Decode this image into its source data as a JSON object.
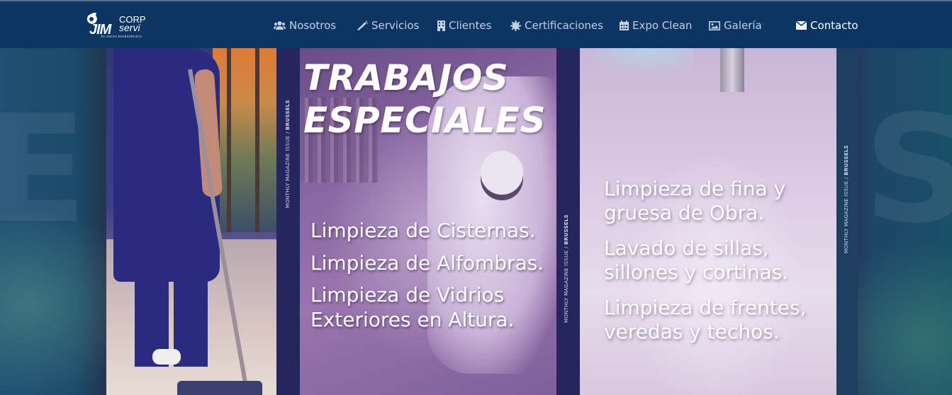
{
  "brand": {
    "logo_text_corp": "CORP",
    "logo_text_jim": "JIM",
    "logo_text_servi": "servi",
    "logo_tagline": "TU SOCIO ESTRATÉGICO"
  },
  "nav": {
    "items": [
      {
        "label": "Nosotros",
        "icon": "users-icon"
      },
      {
        "label": "Servicios",
        "icon": "spray-icon"
      },
      {
        "label": "Clientes",
        "icon": "building-icon"
      },
      {
        "label": "Certificaciones",
        "icon": "certificate-icon"
      },
      {
        "label": "Expo Clean",
        "icon": "calendar-icon"
      },
      {
        "label": "Galería",
        "icon": "image-icon"
      }
    ],
    "contact": {
      "label": "Contacto",
      "icon": "envelope-icon"
    }
  },
  "hero": {
    "headline_line1": "TRABAJOS",
    "headline_line2": "ESPECIALES",
    "strip_label_prefix": "MONTHLY MAGAZINE ISSUE /",
    "strip_label_city": "BRUSSELS",
    "services_left": [
      "Limpieza de Cisternas.",
      "Limpieza de Alfombras.",
      "Limpieza de Vidrios",
      "Exteriores en Altura."
    ],
    "services_right": [
      "Limpieza de fina y",
      "gruesa de Obra.",
      "Lavado de sillas,",
      "sillones y cortinas.",
      "Limpieza de frentes,",
      "veredas y techos."
    ]
  },
  "colors": {
    "nav_bg": "#0c3564",
    "nav_text": "#c4cfe0",
    "panel_purple": "#8a67a3",
    "panel_lilac": "#dccbe4"
  }
}
